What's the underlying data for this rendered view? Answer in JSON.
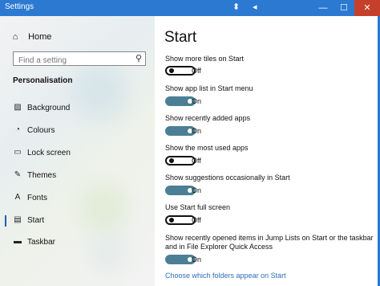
{
  "window": {
    "title": "Settings",
    "controls": {
      "minimize": "—",
      "maximize": "☐",
      "close": "✕"
    }
  },
  "sidebar": {
    "home": {
      "label": "Home",
      "icon": "home-icon"
    },
    "search": {
      "placeholder": "Find a setting",
      "icon": "search-icon"
    },
    "section_title": "Personalisation",
    "items": [
      {
        "label": "Background",
        "icon": "picture-icon",
        "active": false
      },
      {
        "label": "Colours",
        "icon": "palette-icon",
        "active": false
      },
      {
        "label": "Lock screen",
        "icon": "monitor-icon",
        "active": false
      },
      {
        "label": "Themes",
        "icon": "brush-icon",
        "active": false
      },
      {
        "label": "Fonts",
        "icon": "font-icon",
        "active": false
      },
      {
        "label": "Start",
        "icon": "start-icon",
        "active": true
      },
      {
        "label": "Taskbar",
        "icon": "taskbar-icon",
        "active": false
      }
    ]
  },
  "main": {
    "title": "Start",
    "settings": [
      {
        "label": "Show more tiles on Start",
        "on": false,
        "state": "Off"
      },
      {
        "label": "Show app list in Start menu",
        "on": true,
        "state": "On"
      },
      {
        "label": "Show recently added apps",
        "on": true,
        "state": "On"
      },
      {
        "label": "Show the most used apps",
        "on": false,
        "state": "Off"
      },
      {
        "label": "Show suggestions occasionally in Start",
        "on": true,
        "state": "On"
      },
      {
        "label": "Use Start full screen",
        "on": false,
        "state": "Off"
      },
      {
        "label": "Show recently opened items in Jump Lists on Start or the taskbar and in File Explorer Quick Access",
        "on": true,
        "state": "On"
      }
    ],
    "link": "Choose which folders appear on Start"
  },
  "colors": {
    "accent": "#2b79d1",
    "toggle_on": "#4b7f95",
    "link": "#2f6db5"
  }
}
